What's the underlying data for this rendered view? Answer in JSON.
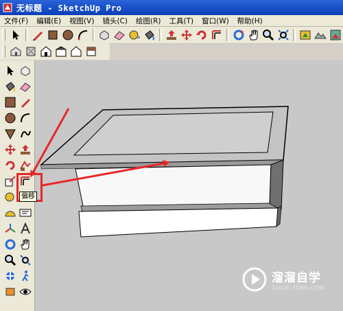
{
  "window": {
    "title": "无标题 - SketchUp Pro"
  },
  "menu": [
    "文件(F)",
    "编辑(E)",
    "视图(V)",
    "镜头(C)",
    "绘图(R)",
    "工具(T)",
    "窗口(W)",
    "帮助(H)"
  ],
  "tooltip": {
    "text": "偏移"
  },
  "watermark": {
    "name": "溜溜自学",
    "url": "ZIXUE.3D66.COM"
  },
  "colors": {
    "highlight": "#e8262a",
    "canvas": "#c8c8c8",
    "titlebar": "#0b3fb8"
  }
}
